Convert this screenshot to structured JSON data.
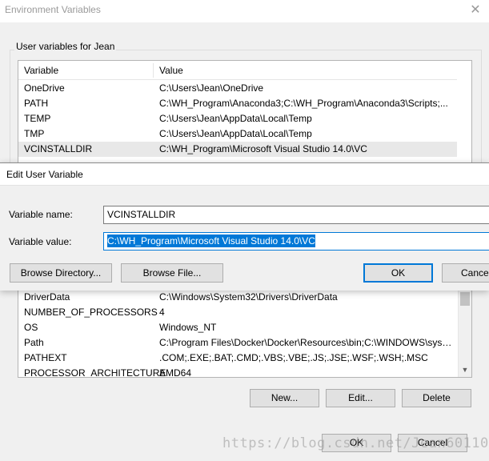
{
  "env_window": {
    "title": "Environment Variables",
    "close_glyph": "✕",
    "user_group_label": "User variables for Jean",
    "columns": {
      "variable": "Variable",
      "value": "Value"
    },
    "user_vars": [
      {
        "name": "OneDrive",
        "value": "C:\\Users\\Jean\\OneDrive"
      },
      {
        "name": "PATH",
        "value": "C:\\WH_Program\\Anaconda3;C:\\WH_Program\\Anaconda3\\Scripts;..."
      },
      {
        "name": "TEMP",
        "value": "C:\\Users\\Jean\\AppData\\Local\\Temp"
      },
      {
        "name": "TMP",
        "value": "C:\\Users\\Jean\\AppData\\Local\\Temp"
      },
      {
        "name": "VCINSTALLDIR",
        "value": "C:\\WH_Program\\Microsoft Visual Studio 14.0\\VC"
      }
    ],
    "selected_user_var": "VCINSTALLDIR",
    "system_vars": [
      {
        "name": "DriverData",
        "value": "C:\\Windows\\System32\\Drivers\\DriverData"
      },
      {
        "name": "NUMBER_OF_PROCESSORS",
        "value": "4"
      },
      {
        "name": "OS",
        "value": "Windows_NT"
      },
      {
        "name": "Path",
        "value": "C:\\Program Files\\Docker\\Docker\\Resources\\bin;C:\\WINDOWS\\syst..."
      },
      {
        "name": "PATHEXT",
        "value": ".COM;.EXE;.BAT;.CMD;.VBS;.VBE;.JS;.JSE;.WSF;.WSH;.MSC"
      },
      {
        "name": "PROCESSOR_ARCHITECTURE",
        "value": "AMD64"
      }
    ],
    "system_buttons": {
      "new": "New...",
      "edit": "Edit...",
      "delete": "Delete"
    },
    "ok": "OK",
    "cancel": "Cancel"
  },
  "edit_dialog": {
    "title": "Edit User Variable",
    "name_label": "Variable name:",
    "name_value": "VCINSTALLDIR",
    "value_label": "Variable value:",
    "value_value": "C:\\WH_Program\\Microsoft Visual Studio 14.0\\VC",
    "browse_directory": "Browse Directory...",
    "browse_file": "Browse File...",
    "ok": "OK",
    "cancel": "Cancel"
  },
  "watermark": "https://blog.csdn.net/Jean601100",
  "colors": {
    "selection": "#0078d7",
    "default_button_border": "#0078d7",
    "selected_row": "#e8e8e8"
  },
  "icons": {
    "close": "close-icon",
    "scroll_up": "scroll-up-arrow-icon",
    "scroll_down": "scroll-down-arrow-icon"
  }
}
